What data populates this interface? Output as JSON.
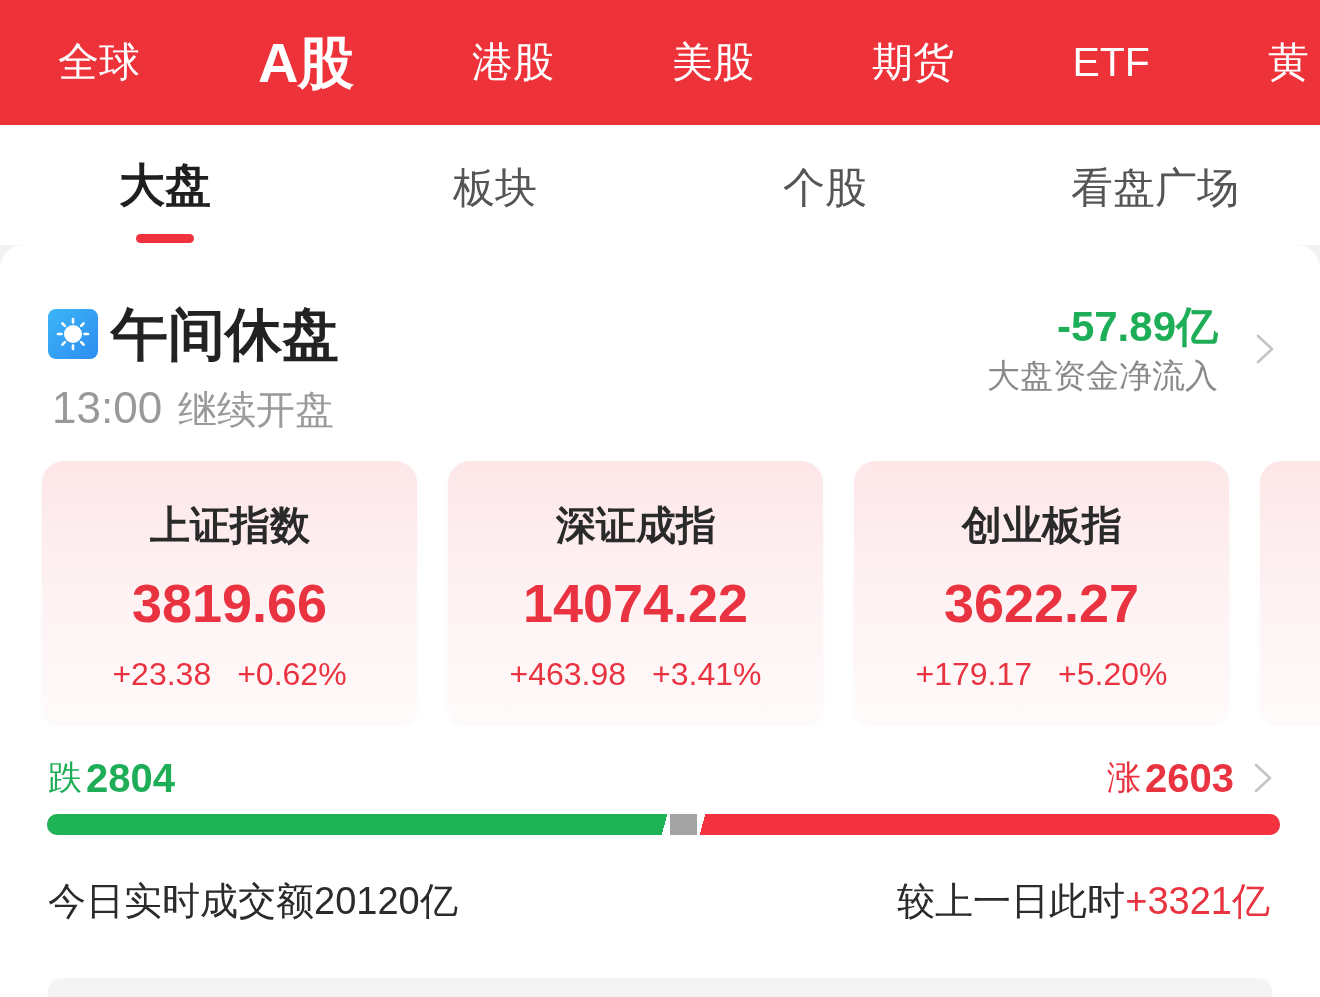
{
  "market_tabs": [
    {
      "label": "全球",
      "selected": false
    },
    {
      "label": "A股",
      "selected": true
    },
    {
      "label": "港股",
      "selected": false
    },
    {
      "label": "美股",
      "selected": false
    },
    {
      "label": "期货",
      "selected": false
    },
    {
      "label": "ETF",
      "selected": false
    },
    {
      "label": "黄",
      "selected": false
    }
  ],
  "view_tabs": [
    {
      "label": "大盘",
      "selected": true
    },
    {
      "label": "板块",
      "selected": false
    },
    {
      "label": "个股",
      "selected": false
    },
    {
      "label": "看盘广场",
      "selected": false
    }
  ],
  "session": {
    "title": "午间休盘",
    "resume_time": "13:00",
    "resume_label": "继续开盘"
  },
  "fund_flow": {
    "value": "-57.89亿",
    "label": "大盘资金净流入"
  },
  "indices": [
    {
      "name": "上证指数",
      "value": "3819.66",
      "change": "+23.38",
      "change_pct": "+0.62%"
    },
    {
      "name": "深证成指",
      "value": "14074.22",
      "change": "+463.98",
      "change_pct": "+3.41%"
    },
    {
      "name": "创业板指",
      "value": "3622.27",
      "change": "+179.17",
      "change_pct": "+5.20%"
    }
  ],
  "breadth": {
    "down_label": "跌",
    "down_count": "2804",
    "up_label": "涨",
    "up_count": "2603",
    "segments": [
      {
        "kind": "down",
        "level": 0.505
      },
      {
        "kind": "up",
        "level": 0.473
      }
    ]
  },
  "turnover": {
    "label": "今日实时成交额20120亿",
    "compare_label": "较上一日此时",
    "compare_value": "+3321亿"
  }
}
